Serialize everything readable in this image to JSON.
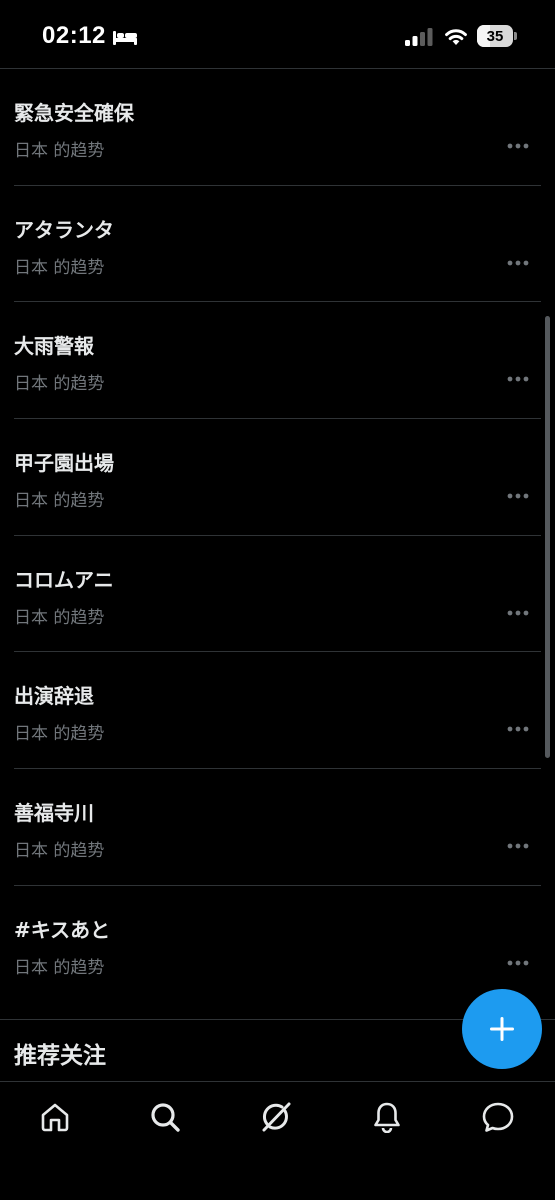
{
  "status_bar": {
    "time": "02:12",
    "battery_level": "35",
    "battery_fraction": 0.35,
    "icons": [
      "bed-icon",
      "cellular-signal-icon",
      "wifi-icon",
      "battery-icon"
    ]
  },
  "trends": [
    {
      "title": "緊急安全確保",
      "subtitle": "日本 的趋势"
    },
    {
      "title": "アタランタ",
      "subtitle": "日本 的趋势"
    },
    {
      "title": "大雨警報",
      "subtitle": "日本 的趋势"
    },
    {
      "title": "甲子園出場",
      "subtitle": "日本 的趋势"
    },
    {
      "title": "コロムアニ",
      "subtitle": "日本 的趋势"
    },
    {
      "title": "出演辞退",
      "subtitle": "日本 的趋势"
    },
    {
      "title": "善福寺川",
      "subtitle": "日本 的趋势"
    },
    {
      "title": "#キスあと",
      "subtitle": "日本 的趋势"
    }
  ],
  "section": {
    "title": "推荐关注"
  },
  "fab": {
    "icon": "plus-icon"
  },
  "bottom_nav": {
    "items": [
      "home-icon",
      "search-icon",
      "grok-icon",
      "notifications-bell-icon",
      "messages-icon"
    ]
  },
  "colors": {
    "background": "#000000",
    "text_primary": "#e7e9ea",
    "text_secondary": "#71767b",
    "divider": "#2f3336",
    "accent": "#1d9bf0"
  }
}
